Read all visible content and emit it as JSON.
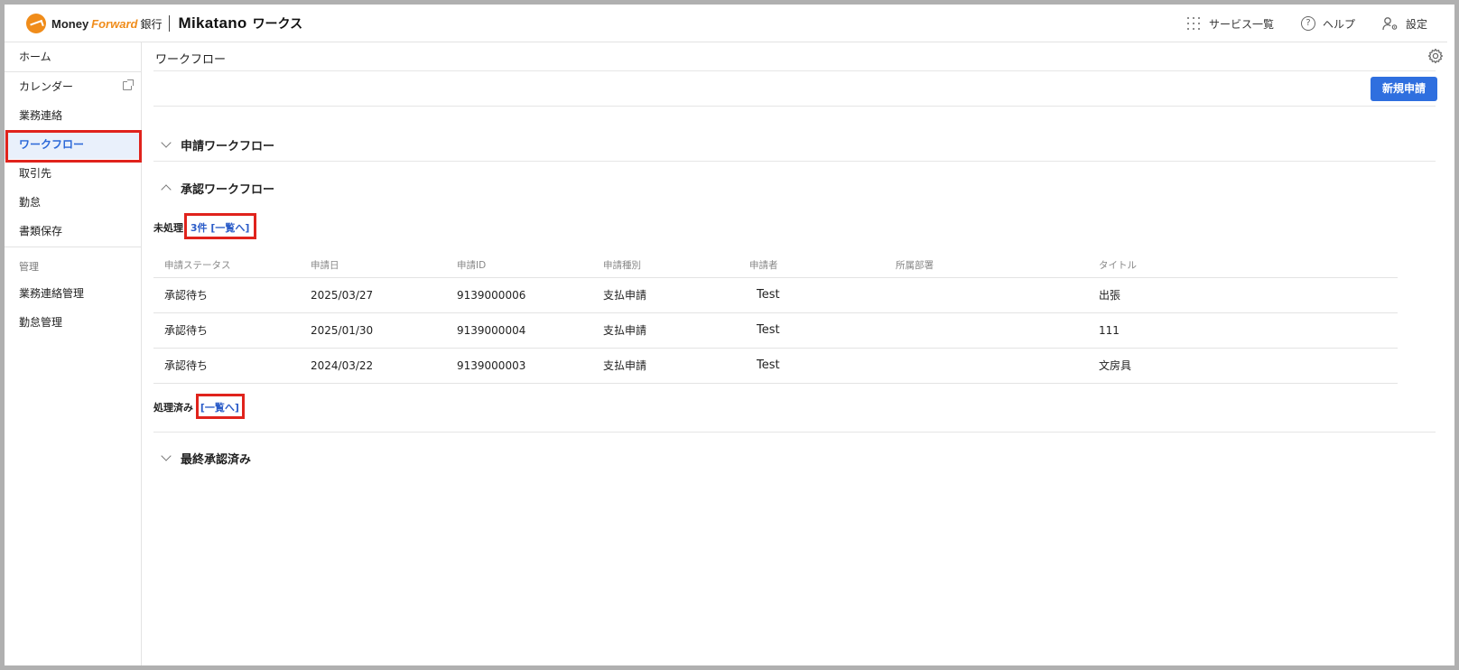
{
  "header": {
    "brand_money": "Money",
    "brand_forward": "Forward",
    "brand_bank": "銀行",
    "app_name": "Mikatano",
    "app_suffix": "ワークス",
    "actions": [
      {
        "label": "サービス一覧",
        "icon": "grid-icon"
      },
      {
        "label": "ヘルプ",
        "icon": "help-icon"
      },
      {
        "label": "設定",
        "icon": "user-settings-icon"
      }
    ]
  },
  "sidebar": {
    "items": [
      {
        "label": "ホーム"
      },
      {
        "label": "カレンダー",
        "icon": "external-link-icon"
      },
      {
        "label": "業務連絡"
      },
      {
        "label": "ワークフロー",
        "active": true
      },
      {
        "label": "取引先"
      },
      {
        "label": "勤怠"
      },
      {
        "label": "書類保存"
      }
    ],
    "admin_section": "管理",
    "admin_items": [
      {
        "label": "業務連絡管理"
      },
      {
        "label": "勤怠管理"
      }
    ]
  },
  "main": {
    "title": "ワークフロー",
    "new_button": "新規申請",
    "sections": {
      "apply": "申請ワークフロー",
      "approve": "承認ワークフロー",
      "final": "最終承認済み"
    },
    "pending_label": "未処理",
    "pending_link": "3件 [一覧へ]",
    "processed_label": "処理済み",
    "processed_link": "[一覧へ]",
    "table": {
      "headers": [
        "申請ステータス",
        "申請日",
        "申請ID",
        "申請種別",
        "申請者",
        "所属部署",
        "タイトル"
      ],
      "rows": [
        [
          "承認待ち",
          "2025/03/27",
          "9139000006",
          "支払申請",
          "Test",
          "",
          "出張"
        ],
        [
          "承認待ち",
          "2025/01/30",
          "9139000004",
          "支払申請",
          "Test",
          "",
          "111"
        ],
        [
          "承認待ち",
          "2024/03/22",
          "9139000003",
          "支払申請",
          "Test",
          "",
          "文房具"
        ]
      ]
    }
  },
  "colors": {
    "accent": "#2f6fdf",
    "brand_orange": "#f08c1a",
    "highlight_red": "#e0231c",
    "active_bg": "#e9f0fb"
  }
}
